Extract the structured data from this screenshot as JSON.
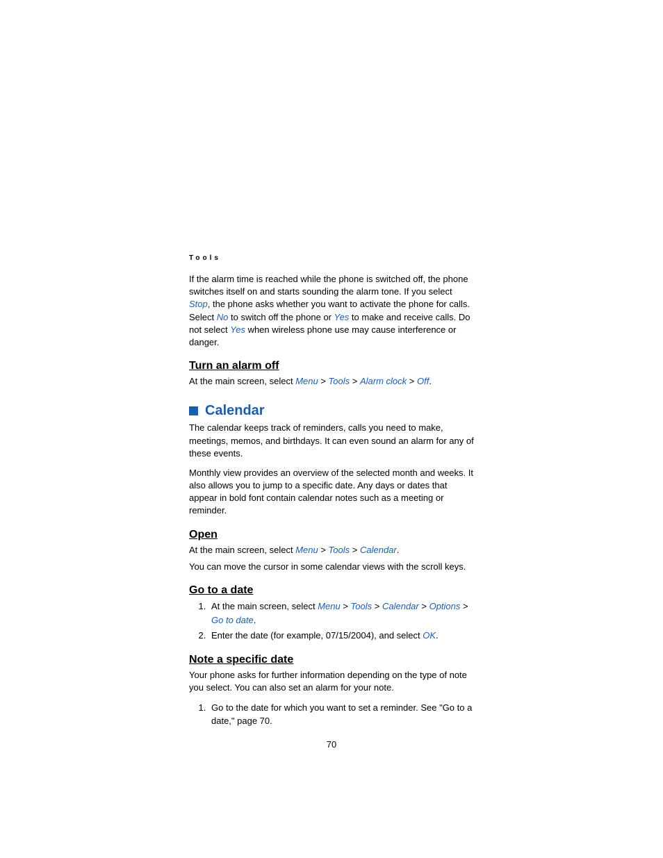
{
  "header": "Tools",
  "intro": {
    "p1a": "If the alarm time is reached while the phone is switched off, the phone switches itself on and starts sounding the alarm tone. If you select ",
    "stop": "Stop",
    "p1b": ", the phone asks whether you want to activate the phone for calls. Select ",
    "no": "No",
    "p1c": " to switch off the phone or ",
    "yes": "Yes",
    "p1d": " to make and receive calls. Do not select ",
    "yes2": "Yes",
    "p1e": " when wireless phone use may cause interference or danger."
  },
  "turnoff": {
    "heading": "Turn an alarm off",
    "p_a": "At the main screen, select ",
    "menu": "Menu",
    "gt1": " > ",
    "tools": "Tools",
    "gt2": " > ",
    "alarm": "Alarm clock",
    "gt3": " > ",
    "off": "Off",
    "period": "."
  },
  "calendar": {
    "heading": "Calendar",
    "p1": "The calendar keeps track of reminders, calls you need to make, meetings, memos, and birthdays. It can even sound an alarm for any of these events.",
    "p2": "Monthly view provides an overview of the selected month and weeks. It also allows you to jump to a specific date. Any days or dates that appear in bold font contain calendar notes such as a meeting or reminder."
  },
  "open": {
    "heading": "Open",
    "p_a": "At the main screen, select ",
    "menu": "Menu",
    "gt1": " > ",
    "tools": "Tools",
    "gt2": " > ",
    "cal": "Calendar",
    "period": ".",
    "p2": "You can move the cursor in some calendar views with the scroll keys."
  },
  "gotodate": {
    "heading": "Go to a date",
    "step1a": "At the main screen, select ",
    "menu": "Menu",
    "gt1": " > ",
    "tools": "Tools",
    "gt2": " > ",
    "cal": "Calendar",
    "gt3": " > ",
    "options": "Options",
    "gt4": " > ",
    "goto": "Go to date",
    "period1": ".",
    "step2a": "Enter the date (for example, 07/15/2004), and select ",
    "ok": "OK",
    "period2": "."
  },
  "note": {
    "heading": "Note a specific date",
    "p1": "Your phone asks for further information depending on the type of note you select. You can also set an alarm for your note.",
    "step1": "Go to the date for which you want to set a reminder. See \"Go to a date,\" page 70."
  },
  "page_number": "70"
}
